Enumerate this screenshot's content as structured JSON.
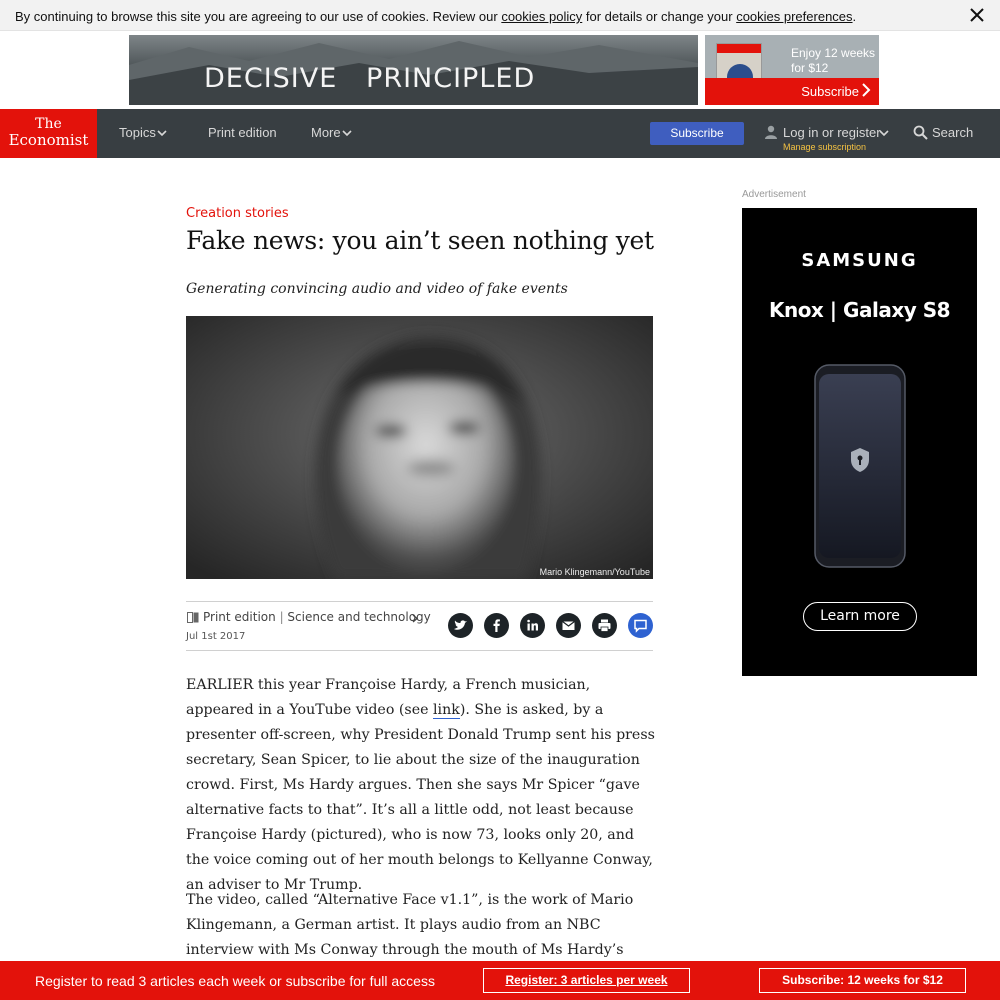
{
  "cookie_bar": {
    "text_before": "By continuing to browse this site you are agreeing to our use of cookies. Review our ",
    "policy_link": "cookies policy",
    "text_middle": " for details or change your ",
    "preferences_link": "cookies preferences",
    "text_after": ".",
    "close_icon": "close-icon"
  },
  "top_ads": {
    "banner_slogan": "DECISIVE   PRINCIPLED",
    "promo_offer": "Enjoy 12 weeks for $12",
    "promo_cta": "Subscribe"
  },
  "nav": {
    "logo_line1": "The",
    "logo_line2": "Economist",
    "topics": "Topics",
    "print_edition": "Print edition",
    "more": "More",
    "subscribe": "Subscribe",
    "login": "Log in or register",
    "manage": "Manage subscription",
    "search": "Search"
  },
  "article": {
    "flytitle": "Creation stories",
    "headline": "Fake news: you ain’t seen nothing yet",
    "rubric": "Generating convincing audio and video of fake events",
    "image_credit": "Mario Klingemann/YouTube",
    "section_print": "Print edition",
    "section_sep": " | ",
    "section_topic": "Science and technology",
    "date": "Jul 1st 2017",
    "share_icons": [
      "twitter-icon",
      "facebook-icon",
      "linkedin-icon",
      "email-icon",
      "print-icon",
      "comment-icon"
    ],
    "p1_a": "EARLIER this year Françoise Hardy, a French musician, appeared in a YouTube video (see ",
    "p1_link": "link",
    "p1_b": "). She is asked, by a presenter off-screen, why President Donald Trump sent his press secretary, Sean Spicer, to lie about the size of the inauguration crowd. First, Ms Hardy argues. Then she says Mr Spicer “gave alternative facts to that”. It’s all a little odd, not least because Françoise Hardy (pictured), who is now 73, looks only 20, and the voice coming out of her mouth belongs to Kellyanne Conway, an adviser to Mr Trump.",
    "p2": "The video, called “Alternative Face v1.1”, is the work of Mario Klingemann, a German artist. It plays audio from an NBC interview with Ms Conway through the mouth of Ms Hardy’s digital ghost. The"
  },
  "side_ad": {
    "label": "Advertisement",
    "brand": "SAMSUNG",
    "product": "Knox | Galaxy S8",
    "cta": "Learn more"
  },
  "register_bar": {
    "text": "Register to read 3 articles each week or subscribe for full access",
    "register_button": "Register: 3 articles per week",
    "subscribe_button": "Subscribe: 12 weeks for $12"
  },
  "colors": {
    "brand_red": "#e3120b",
    "nav_dark": "#383e42",
    "subscribe_blue": "#3f5ebf",
    "manage_yellow": "#f4c242"
  }
}
